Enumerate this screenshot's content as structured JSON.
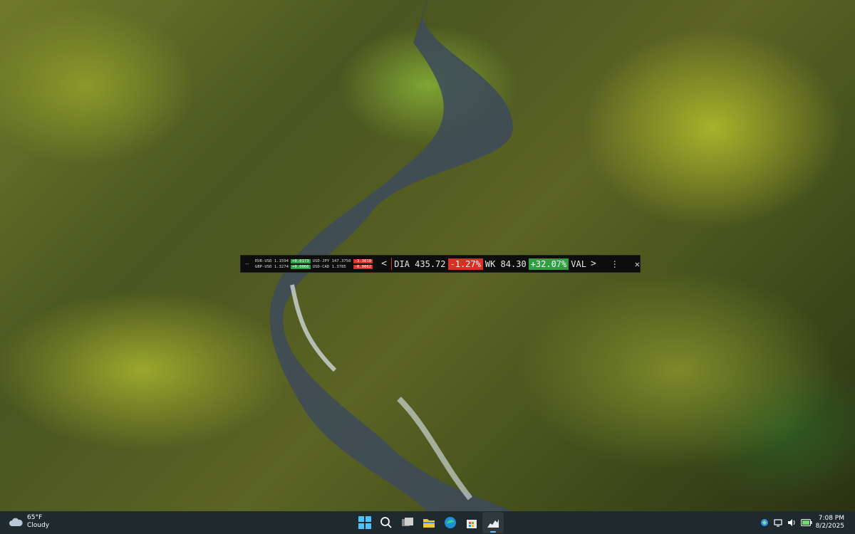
{
  "ticker": {
    "mini_quotes": [
      {
        "pair": "EUR-USD",
        "price": "1.1594",
        "change": "+0.0173",
        "direction": "up"
      },
      {
        "pair": "USD-JPY",
        "price": "147.3750",
        "change": "-3.3010",
        "direction": "down"
      },
      {
        "pair": "GBP-USD",
        "price": "1.3274",
        "change": "+0.0066",
        "direction": "up"
      },
      {
        "pair": "USD-CAD",
        "price": "1.3785",
        "change": "-0.0062",
        "direction": "down"
      }
    ],
    "prev_label": "<",
    "next_label": ">",
    "items": [
      {
        "symbol": "DIA",
        "price": "435.72",
        "change": "-1.27%",
        "direction": "down"
      },
      {
        "symbol": "WK",
        "price": "84.30",
        "change": "+32.07%",
        "direction": "up"
      },
      {
        "symbol": "VAL",
        "price": "",
        "change": "",
        "direction": ""
      }
    ],
    "menu_label": "⋮",
    "close_label": "✕"
  },
  "taskbar": {
    "weather": {
      "temp": "65°F",
      "condition": "Cloudy",
      "icon": "cloud-icon"
    },
    "apps": [
      {
        "name": "start-icon"
      },
      {
        "name": "search-icon"
      },
      {
        "name": "task-view-icon"
      },
      {
        "name": "file-explorer-icon"
      },
      {
        "name": "edge-icon"
      },
      {
        "name": "store-icon"
      },
      {
        "name": "stock-ticker-app-icon",
        "active": true
      }
    ],
    "clock": {
      "time": "7:08 PM",
      "date": "8/2/2025"
    }
  },
  "colors": {
    "positive": "#2ea043",
    "negative": "#d93025",
    "taskbar": "#1f2a2e"
  }
}
